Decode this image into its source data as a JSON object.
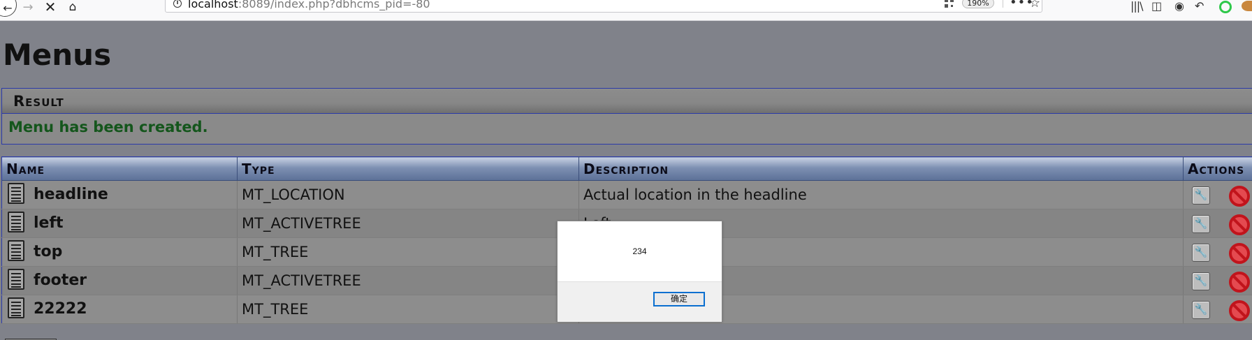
{
  "browser": {
    "back_glyph": "←",
    "forward_glyph": "→",
    "stop_glyph": "✕",
    "home_glyph": "⌂",
    "url_host": "localhost",
    "url_rest": ":8089/index.php?dbhcms_pid=-80",
    "zoom": "190%",
    "more_glyph": "•••",
    "star_glyph": "☆",
    "library_glyph": "|||\\",
    "sidebar_glyph": "◫",
    "account_glyph": "◉",
    "undo_glyph": "↶"
  },
  "page": {
    "title": "Menus"
  },
  "result": {
    "heading": "Result",
    "message": "Menu has been created.",
    "message_color": "#14561c"
  },
  "table": {
    "headers": {
      "name": "Name",
      "type": "Type",
      "description": "Description",
      "actions": "Actions"
    },
    "rows": [
      {
        "name": "headline",
        "type": "MT_LOCATION",
        "description": "Actual location in the headline"
      },
      {
        "name": "left",
        "type": "MT_ACTIVETREE",
        "description": "Left"
      },
      {
        "name": "top",
        "type": "MT_TREE",
        "description": ""
      },
      {
        "name": "footer",
        "type": "MT_ACTIVETREE",
        "description": ""
      },
      {
        "name": "22222",
        "type": "MT_TREE",
        "description": ""
      }
    ]
  },
  "alert": {
    "message": "234",
    "ok_label": "确定",
    "ok_border_color": "#0a6fd0"
  },
  "icons": {
    "row_icon": "document-icon",
    "edit": "wrench-icon",
    "delete": "no-entry-icon",
    "edit_glyph": "🔧"
  }
}
